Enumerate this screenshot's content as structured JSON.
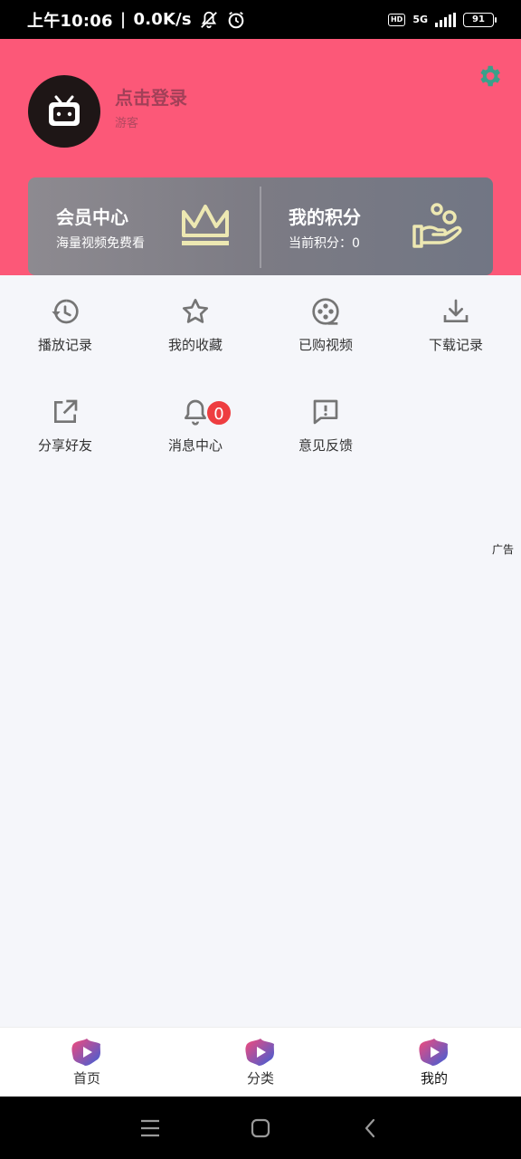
{
  "status_bar": {
    "time": "上午10:06",
    "speed": "0.0K/s",
    "hd": "HD",
    "network": "5G",
    "battery": "91"
  },
  "header": {
    "login_title": "点击登录",
    "login_subtitle": "游客",
    "settings_icon": "gear-icon"
  },
  "vip": {
    "member_title": "会员中心",
    "member_subtitle": "海量视频免费看",
    "points_title": "我的积分",
    "points_subtitle": "当前积分：0"
  },
  "menu": {
    "play_history": "播放记录",
    "favorites": "我的收藏",
    "purchased": "已购视频",
    "downloads": "下载记录",
    "share": "分享好友",
    "messages": "消息中心",
    "messages_badge": "0",
    "feedback": "意见反馈"
  },
  "ad_label": "广告",
  "bottom_nav": {
    "home": "首页",
    "category": "分类",
    "mine": "我的"
  },
  "colors": {
    "header_bg": "#fc5878",
    "accent_gold": "#ede8b2",
    "badge_red": "#ee3d40",
    "icon_gray": "#757575"
  }
}
